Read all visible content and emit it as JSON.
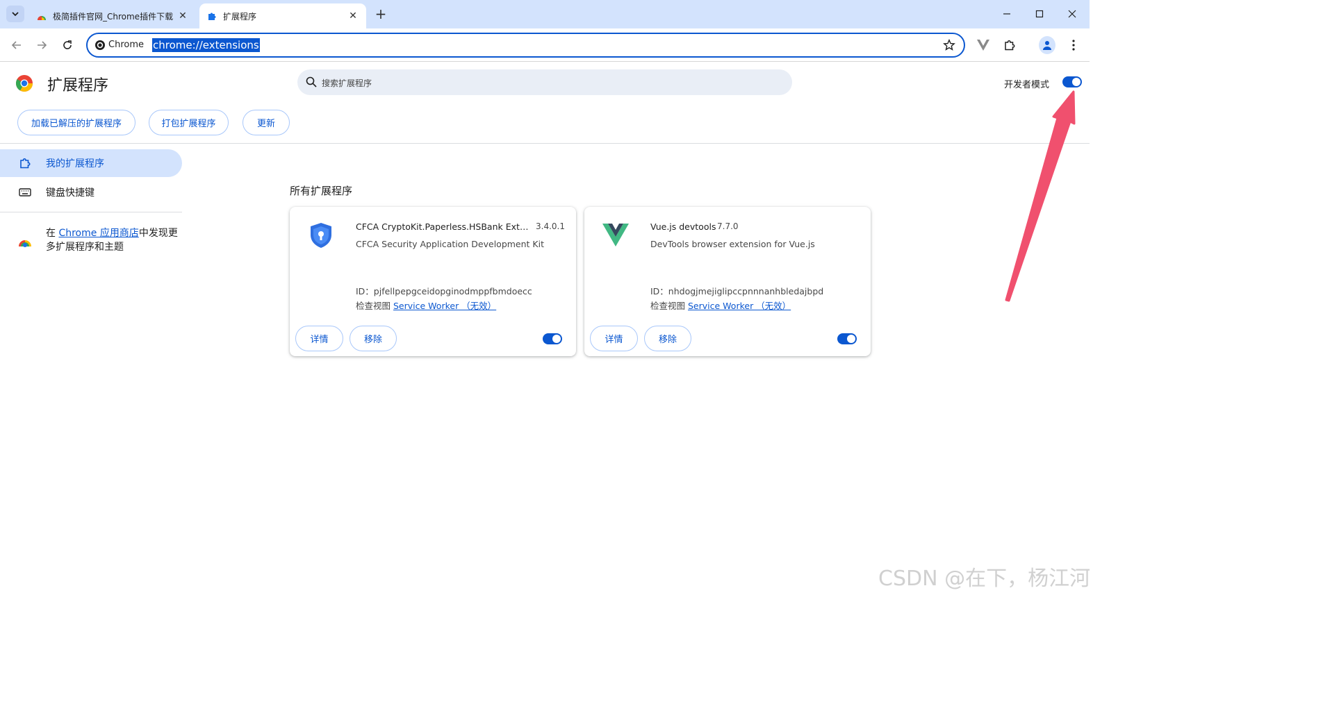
{
  "browser": {
    "tabs": [
      {
        "title": "极简插件官网_Chrome插件下载",
        "close": "✕"
      },
      {
        "title": "扩展程序",
        "close": "✕"
      }
    ],
    "new_tab": "+",
    "omnibox": {
      "chip": "Chrome",
      "url": "chrome://extensions"
    }
  },
  "page": {
    "title": "扩展程序",
    "search_placeholder": "搜索扩展程序",
    "dev_mode_label": "开发者模式",
    "dev_mode_on": true,
    "actions": {
      "load_unpacked": "加载已解压的扩展程序",
      "pack": "打包扩展程序",
      "update": "更新"
    }
  },
  "sidebar": {
    "items": [
      {
        "label": "我的扩展程序"
      },
      {
        "label": "键盘快捷键"
      }
    ],
    "promo": {
      "prefix": "在 ",
      "link": "Chrome 应用商店",
      "suffix": "中发现更多扩展程序和主题"
    }
  },
  "main": {
    "section_title": "所有扩展程序",
    "extensions": [
      {
        "name": "CFCA CryptoKit.Paperless.HSBank Extens...",
        "version": "3.4.0.1",
        "description": "CFCA Security Application Development Kit",
        "id_line": "ID：pjfellpepgceidopginodmppfbmdoecc",
        "inspect_label": "检查视图",
        "inspect_link": "Service Worker （无效）",
        "details_label": "详情",
        "remove_label": "移除",
        "enabled": true
      },
      {
        "name": "Vue.js devtools",
        "version": "7.7.0",
        "description": "DevTools browser extension for Vue.js",
        "id_line": "ID：nhdogjmejiglipccpnnnanhbledajbpd",
        "inspect_label": "检查视图",
        "inspect_link": "Service Worker （无效）",
        "details_label": "详情",
        "remove_label": "移除",
        "enabled": true
      }
    ]
  },
  "watermark": "CSDN @在下，杨江河",
  "colors": {
    "accent": "#0b57d0",
    "tabstrip": "#d3e3fd",
    "arrow": "#f0506e"
  }
}
